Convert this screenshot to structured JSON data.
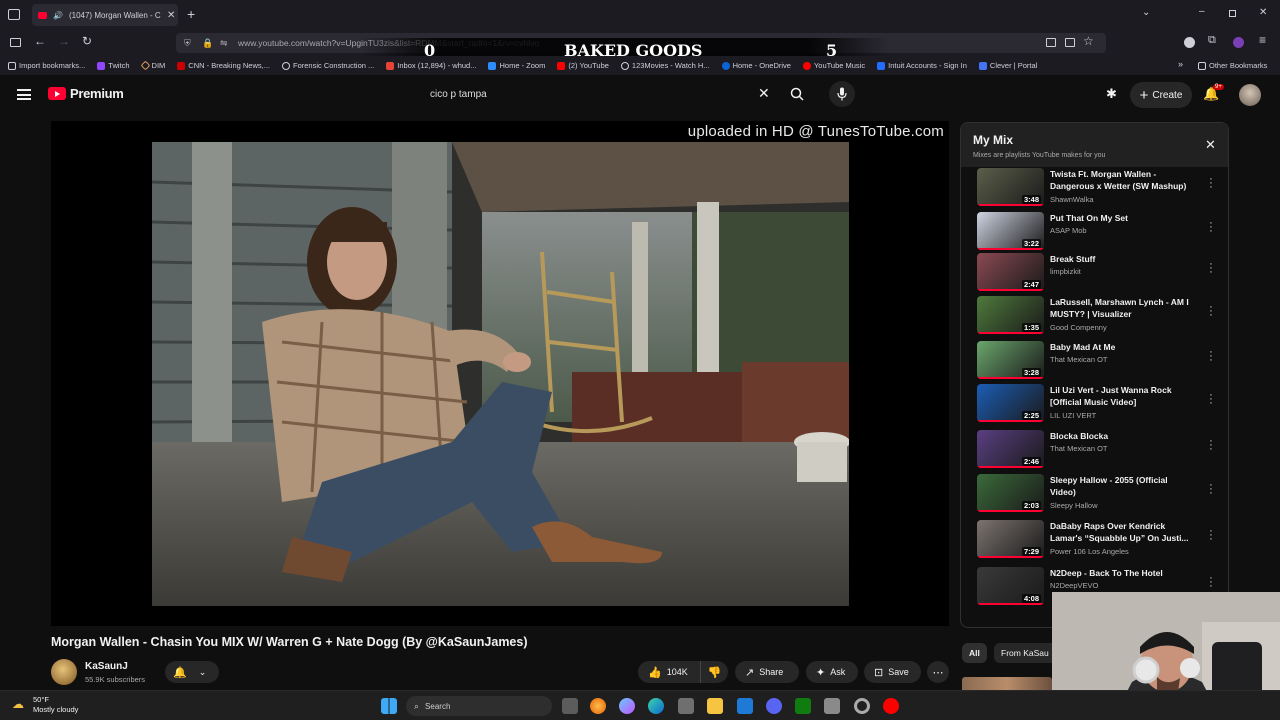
{
  "browser": {
    "tab_title": "(1047) Morgan Wallen - Ch",
    "url": "www.youtube.com/watch?v=UpginTU3zis&list=RDMM&start_radio=1&rv=cvhIvo",
    "bookmarks": [
      "Import bookmarks...",
      "Twitch",
      "DIM",
      "CNN - Breaking News,...",
      "Forensic Construction ...",
      "Inbox (12,894) - whud...",
      "Home - Zoom",
      "(2) YouTube",
      "123Movies - Watch H...",
      "Home - OneDrive",
      "YouTube Music",
      "Intuit Accounts - Sign In",
      "Clever | Portal"
    ],
    "other_bookmarks": "Other Bookmarks"
  },
  "overlay": {
    "left_score": "0",
    "title": "BAKED GOODS",
    "right_score": "5"
  },
  "youtube": {
    "brand": "Premium",
    "search_value": "cico p tampa",
    "create_label": "Create",
    "notification_badge": "9+"
  },
  "video": {
    "watermark": "uploaded in HD @ TunesToTube.com",
    "title": "Morgan Wallen - Chasin You MIX W/ Warren G + Nate Dogg (By @KaSaunJames)",
    "channel_name": "KaSaunJ",
    "subscribers": "55.9K subscribers",
    "like_count": "104K",
    "share_label": "Share",
    "ask_label": "Ask",
    "save_label": "Save"
  },
  "mix": {
    "title": "My Mix",
    "subtitle": "Mixes are playlists YouTube makes for you",
    "items": [
      {
        "title": "Twista Ft. Morgan Wallen - Dangerous x Wetter (SW Mashup)",
        "channel": "ShawnWalka",
        "duration": "3:48",
        "color": "#5b5f4a"
      },
      {
        "title": "Put That On My Set",
        "channel": "ASAP Mob",
        "duration": "3:22",
        "color": "#cfd4e2"
      },
      {
        "title": "Break Stuff",
        "channel": "limpbizkit",
        "duration": "2:47",
        "color": "#8a4a52"
      },
      {
        "title": "LaRussell, Marshawn Lynch - AM I MUSTY? | Visualizer",
        "channel": "Good Compenny",
        "duration": "1:35",
        "color": "#4f7a3c"
      },
      {
        "title": "Baby Mad At Me",
        "channel": "That Mexican OT",
        "duration": "3:28",
        "color": "#6aa66c"
      },
      {
        "title": "Lil Uzi Vert - Just Wanna Rock [Official Music Video]",
        "channel": "LIL UZI VERT",
        "duration": "2:25",
        "color": "#1b5db5"
      },
      {
        "title": "Blocka Blocka",
        "channel": "That Mexican OT",
        "duration": "2:46",
        "color": "#5a3f82"
      },
      {
        "title": "Sleepy Hallow - 2055 (Official Video)",
        "channel": "Sleepy Hallow",
        "duration": "2:03",
        "color": "#3b6a3a"
      },
      {
        "title": "DaBaby Raps Over Kendrick Lamar's “Squabble Up” On Justi...",
        "channel": "Power 106 Los Angeles",
        "duration": "7:29",
        "color": "#7c7470"
      },
      {
        "title": "N2Deep - Back To The Hotel",
        "channel": "N2DeepVEVO",
        "duration": "4:08",
        "color": "#3a3a3a"
      }
    ],
    "chips": [
      "All",
      "From KaSau"
    ]
  },
  "taskbar": {
    "temperature": "50°F",
    "weather": "Mostly cloudy",
    "search_placeholder": "Search"
  }
}
